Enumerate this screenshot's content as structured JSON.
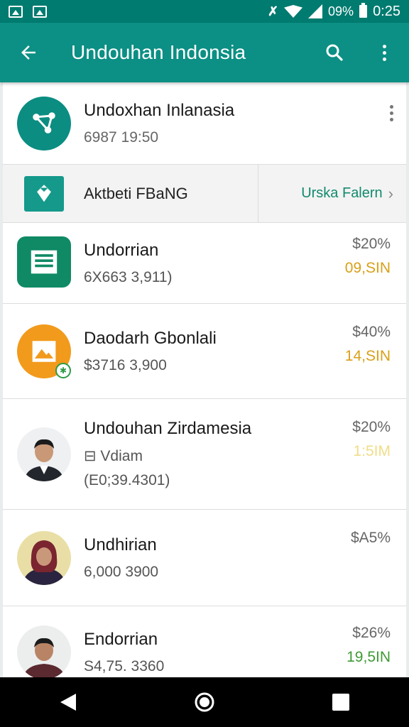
{
  "status_bar": {
    "battery_pct": "09%",
    "time": "0:25"
  },
  "app_bar": {
    "title": "Undouhan Indonsia",
    "back_icon": "arrow-back-icon",
    "search_icon": "search-icon",
    "more_icon": "more-vert-icon"
  },
  "header": {
    "title": "Undoxhan Inlanasia",
    "subtitle": "6987 19:50",
    "icon": "share-icon"
  },
  "promo": {
    "label": "Aktbeti FBaNG",
    "link": "Urska Falern",
    "icon": "shield-icon",
    "chevron": "chevron-right-icon"
  },
  "rows": [
    {
      "title": "Undorrian",
      "subtitle": "6X663 3,911)",
      "pct": "$20%",
      "amount": "09,SIN",
      "amount_color": "#d9a018",
      "icon": "document-icon"
    },
    {
      "title": "Daodarh Gbonlali",
      "subtitle": "$3716 3,900",
      "pct": "$40%",
      "amount": "14,SIN",
      "amount_color": "#d9a018",
      "icon": "image-icon"
    },
    {
      "title": "Undouhan Zirdamesia",
      "subtitle": "⊟ Vdiam",
      "subtitle2": "(E0;39.4301)",
      "pct": "$20%",
      "amount": "1:5IM",
      "amount_color": "#f0dd88",
      "icon": "person-avatar"
    },
    {
      "title": "Undhirian",
      "subtitle": "6,000 3900",
      "pct": "$A5%",
      "amount": "",
      "amount_color": "#666666",
      "icon": "person-avatar"
    },
    {
      "title": "Endorrian",
      "subtitle": "S4,75. 3360",
      "pct": "$26%",
      "amount": "19,5IN",
      "amount_color": "#3f9a35",
      "icon": "person-avatar"
    }
  ],
  "nav_bar": {
    "back": "nav-back-icon",
    "home": "nav-home-icon",
    "recents": "nav-recents-icon"
  }
}
